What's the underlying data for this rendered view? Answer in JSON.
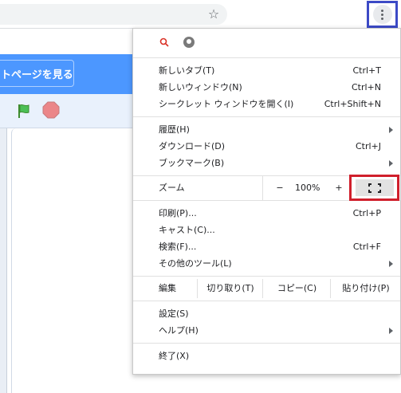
{
  "page": {
    "button_label": "トページを見る"
  },
  "extensions": [
    {
      "icon": "search-icon"
    },
    {
      "icon": "extension-circle-icon"
    }
  ],
  "menu": {
    "group1": [
      {
        "label": "新しいタブ(T)",
        "shortcut": "Ctrl+T"
      },
      {
        "label": "新しいウィンドウ(N)",
        "shortcut": "Ctrl+N"
      },
      {
        "label": "シークレット ウィンドウを開く(I)",
        "shortcut": "Ctrl+Shift+N"
      }
    ],
    "group2": [
      {
        "label": "履歴(H)",
        "shortcut": ""
      },
      {
        "label": "ダウンロード(D)",
        "shortcut": "Ctrl+J"
      },
      {
        "label": "ブックマーク(B)",
        "shortcut": ""
      }
    ],
    "zoom": {
      "label": "ズーム",
      "minus": "−",
      "value": "100%",
      "plus": "+"
    },
    "group3": [
      {
        "label": "印刷(P)...",
        "shortcut": "Ctrl+P"
      },
      {
        "label": "キャスト(C)...",
        "shortcut": ""
      },
      {
        "label": "検索(F)...",
        "shortcut": "Ctrl+F"
      },
      {
        "label": "その他のツール(L)",
        "shortcut": ""
      }
    ],
    "edit": {
      "label": "編集",
      "cut": "切り取り(T)",
      "copy": "コピー(C)",
      "paste": "貼り付け(P)"
    },
    "group4": [
      {
        "label": "設定(S)"
      },
      {
        "label": "ヘルプ(H)"
      }
    ],
    "exit": {
      "label": "終了(X)"
    }
  },
  "colors": {
    "highlight_blue": "#3c4ac6",
    "highlight_red": "#d01f2c",
    "page_accent": "#4c97ff"
  }
}
